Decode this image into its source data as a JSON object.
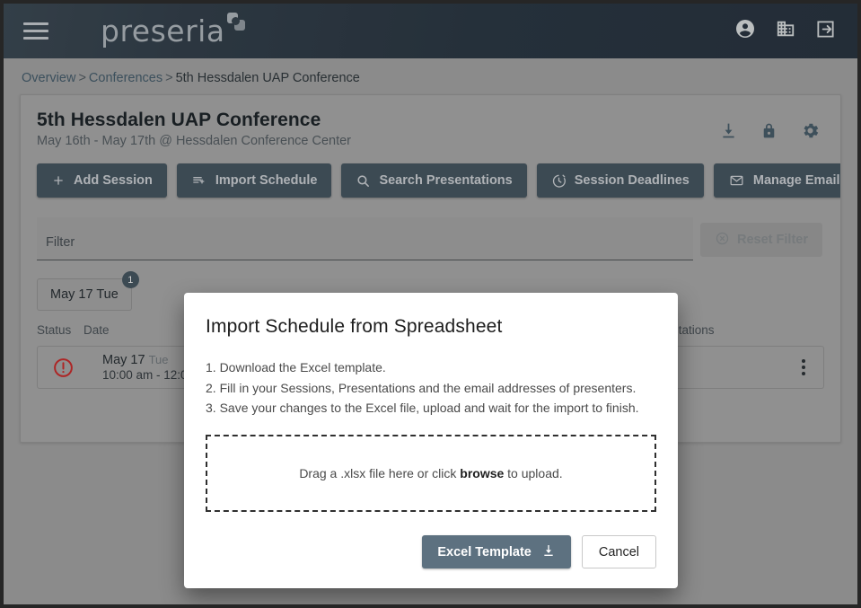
{
  "topbar": {
    "menu_icon": "hamburger-menu-icon",
    "brand": "preseria",
    "icons": [
      {
        "name": "account-circle-icon",
        "label": "Account"
      },
      {
        "name": "business-icon",
        "label": "Organization"
      },
      {
        "name": "logout-icon",
        "label": "Sign out"
      }
    ]
  },
  "breadcrumb": {
    "overview": "Overview",
    "conferences": "Conferences",
    "current": "5th Hessdalen UAP Conference",
    "separator": ">"
  },
  "conference": {
    "title": "5th Hessdalen UAP Conference",
    "subtitle": "May 16th - May 17th @ Hessdalen Conference Center",
    "actions": [
      {
        "name": "download-icon",
        "label": "Download"
      },
      {
        "name": "lock-icon",
        "label": "Lock"
      },
      {
        "name": "gear-icon",
        "label": "Settings"
      }
    ]
  },
  "toolbar": {
    "add_session": "Add Session",
    "import_schedule": "Import Schedule",
    "search_presentations": "Search Presentations",
    "session_deadlines": "Session Deadlines",
    "manage_emails": "Manage Emails"
  },
  "filter": {
    "placeholder": "Filter",
    "value": "",
    "reset_label": "Reset Filter"
  },
  "day_tabs": [
    {
      "label": "May 17 Tue",
      "badge": "1"
    }
  ],
  "table": {
    "columns": {
      "status": "Status",
      "date": "Date",
      "presentations": "Presentations"
    },
    "rows": [
      {
        "status_icon": "error-circle-icon",
        "date": "May 17",
        "day_of_week": "Tue",
        "time": "10:00 am - 12:00 pm",
        "presentations": "",
        "menu_icon": "more-vertical-icon"
      }
    ]
  },
  "modal": {
    "title": "Import Schedule from Spreadsheet",
    "steps": [
      "1. Download the Excel template.",
      "2. Fill in your Sessions, Presentations and the email addresses of presenters.",
      "3. Save your changes to the Excel file, upload and wait for the import to finish."
    ],
    "dropzone": {
      "prefix": "Drag a .xlsx file here or click",
      "link": "browse",
      "suffix": "to upload."
    },
    "primary_button": "Excel Template",
    "secondary_button": "Cancel"
  },
  "colors": {
    "topbar_bg": "#2e3b47",
    "page_bg": "#aaaaaa",
    "button_bg": "#4a5b66",
    "modal_primary": "#5d7180",
    "error": "#d32f2f",
    "badge": "#4a5b66"
  }
}
